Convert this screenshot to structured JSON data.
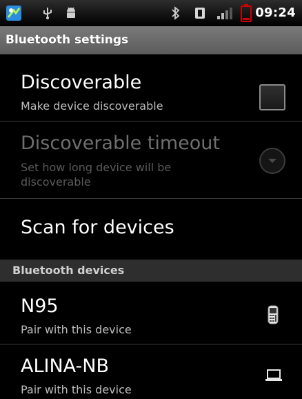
{
  "status_bar": {
    "time": "09:24",
    "icons": [
      "app-notification-icon",
      "usb-icon",
      "android-debug-icon",
      "bluetooth-icon",
      "data-icon",
      "signal-icon",
      "battery-icon"
    ]
  },
  "title_bar": {
    "title": "Bluetooth settings"
  },
  "preferences": {
    "discoverable": {
      "title": "Discoverable",
      "summary": "Make device discoverable",
      "checked": false
    },
    "discoverable_timeout": {
      "title": "Discoverable timeout",
      "summary": "Set how long device will be discoverable",
      "enabled": false
    },
    "scan": {
      "title": "Scan for devices"
    }
  },
  "devices_section": {
    "header": "Bluetooth devices",
    "devices": [
      {
        "name": "N95",
        "summary": "Pair with this device",
        "icon": "phone-icon"
      },
      {
        "name": "ALINA-NB",
        "summary": "Pair with this device",
        "icon": "laptop-icon"
      }
    ]
  },
  "colors": {
    "background": "#000000",
    "title_bar": "#6b6b6b",
    "section_header": "#2e2e2e",
    "battery": "#cc0000"
  }
}
